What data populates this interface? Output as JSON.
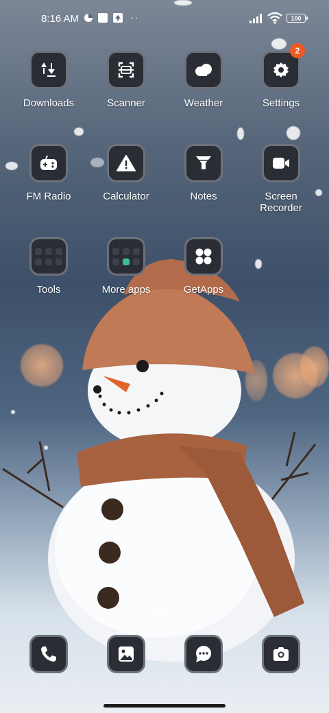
{
  "status_bar": {
    "time": "8:16 AM",
    "battery": "100"
  },
  "apps": [
    {
      "label": "Downloads",
      "icon": "downloads-icon"
    },
    {
      "label": "Scanner",
      "icon": "scanner-icon"
    },
    {
      "label": "Weather",
      "icon": "weather-icon"
    },
    {
      "label": "Settings",
      "icon": "gear-icon",
      "badge": "2"
    },
    {
      "label": "FM Radio",
      "icon": "radio-icon"
    },
    {
      "label": "Calculator",
      "icon": "warning-icon"
    },
    {
      "label": "Notes",
      "icon": "funnel-icon"
    },
    {
      "label": "Screen Recorder",
      "icon": "video-camera-icon"
    },
    {
      "label": "Tools",
      "icon": "folder-icon"
    },
    {
      "label": "More apps",
      "icon": "folder-icon"
    },
    {
      "label": "GetApps",
      "icon": "getapps-icon"
    }
  ],
  "dock": [
    {
      "name": "phone",
      "icon": "phone-icon"
    },
    {
      "name": "gallery",
      "icon": "gallery-icon"
    },
    {
      "name": "messages",
      "icon": "chat-icon"
    },
    {
      "name": "camera",
      "icon": "camera-icon"
    }
  ],
  "colors": {
    "tile_bg": "#2b2d34",
    "tile_border": "#6d717b",
    "badge": "#ef5a24",
    "folder_green": "#3dbf8f"
  },
  "page_indicator": {
    "pages": 2,
    "current": 2
  }
}
